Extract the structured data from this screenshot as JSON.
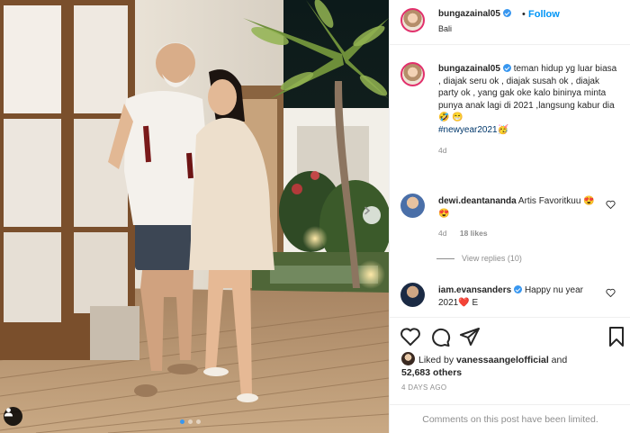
{
  "post": {
    "username": "bungazainal05",
    "follow_label": "Follow",
    "location": "Bali",
    "caption": {
      "text": "teman hidup yg luar biasa , diajak seru ok , diajak susah ok , diajak party ok , yang gak oke kalo bininya minta punya anak lagi di 2021 ,langsung kabur dia 🤣 😁",
      "hashtag": "#newyear2021",
      "hashtag_emoji": "🥳",
      "age": "4d"
    },
    "comments": [
      {
        "username": "dewi.deantananda",
        "text": "Artis Favoritkuu 😍😍",
        "age": "4d",
        "likes": "18 likes",
        "view_replies": "View replies (10)"
      },
      {
        "username": "iam.evansanders",
        "text": "Happy nu year 2021",
        "heart_emoji": "❤️",
        "extra": "E"
      }
    ],
    "likes": {
      "prefix": "Liked by",
      "by_user": "vanessaangelofficial",
      "conjunction": "and",
      "others": "52,683 others"
    },
    "date": "4 DAYS AGO",
    "comments_limited": "Comments on this post have been limited."
  },
  "icons": {
    "heart": "heart-icon",
    "comment": "comment-icon",
    "share": "paper-plane-icon",
    "save": "bookmark-icon",
    "next": "chevron-right-icon",
    "user_tag": "user-tag-icon"
  },
  "colors": {
    "accent": "#0095f6",
    "verified": "#3897f0",
    "heart_red": "#ed4956",
    "muted": "#8e8e8e"
  },
  "carousel": {
    "count": 3,
    "active": 1
  }
}
